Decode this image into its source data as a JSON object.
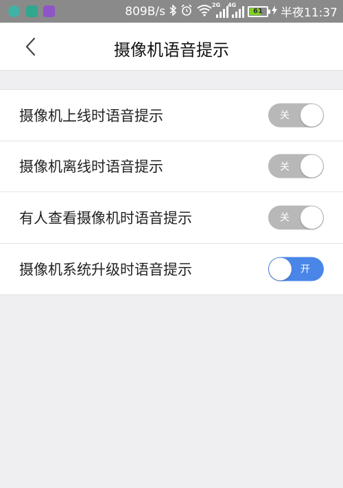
{
  "status_bar": {
    "network_speed": "809B/s",
    "signal1_gen": "2G",
    "signal2_gen": "4G",
    "battery_level": "61",
    "time": "半夜11:37",
    "icons": [
      "bluetooth-icon",
      "alarm-icon",
      "wifi-icon",
      "signal-icon",
      "battery-icon",
      "charging-icon"
    ]
  },
  "header": {
    "title": "摄像机语音提示"
  },
  "settings": [
    {
      "label": "摄像机上线时语音提示",
      "state": "关",
      "on": false
    },
    {
      "label": "摄像机离线时语音提示",
      "state": "关",
      "on": false
    },
    {
      "label": "有人查看摄像机时语音提示",
      "state": "关",
      "on": false
    },
    {
      "label": "摄像机系统升级时语音提示",
      "state": "开",
      "on": true
    }
  ],
  "colors": {
    "switch_on": "#4a86e8",
    "switch_off": "#b8b8b8",
    "background": "#efeef0"
  }
}
